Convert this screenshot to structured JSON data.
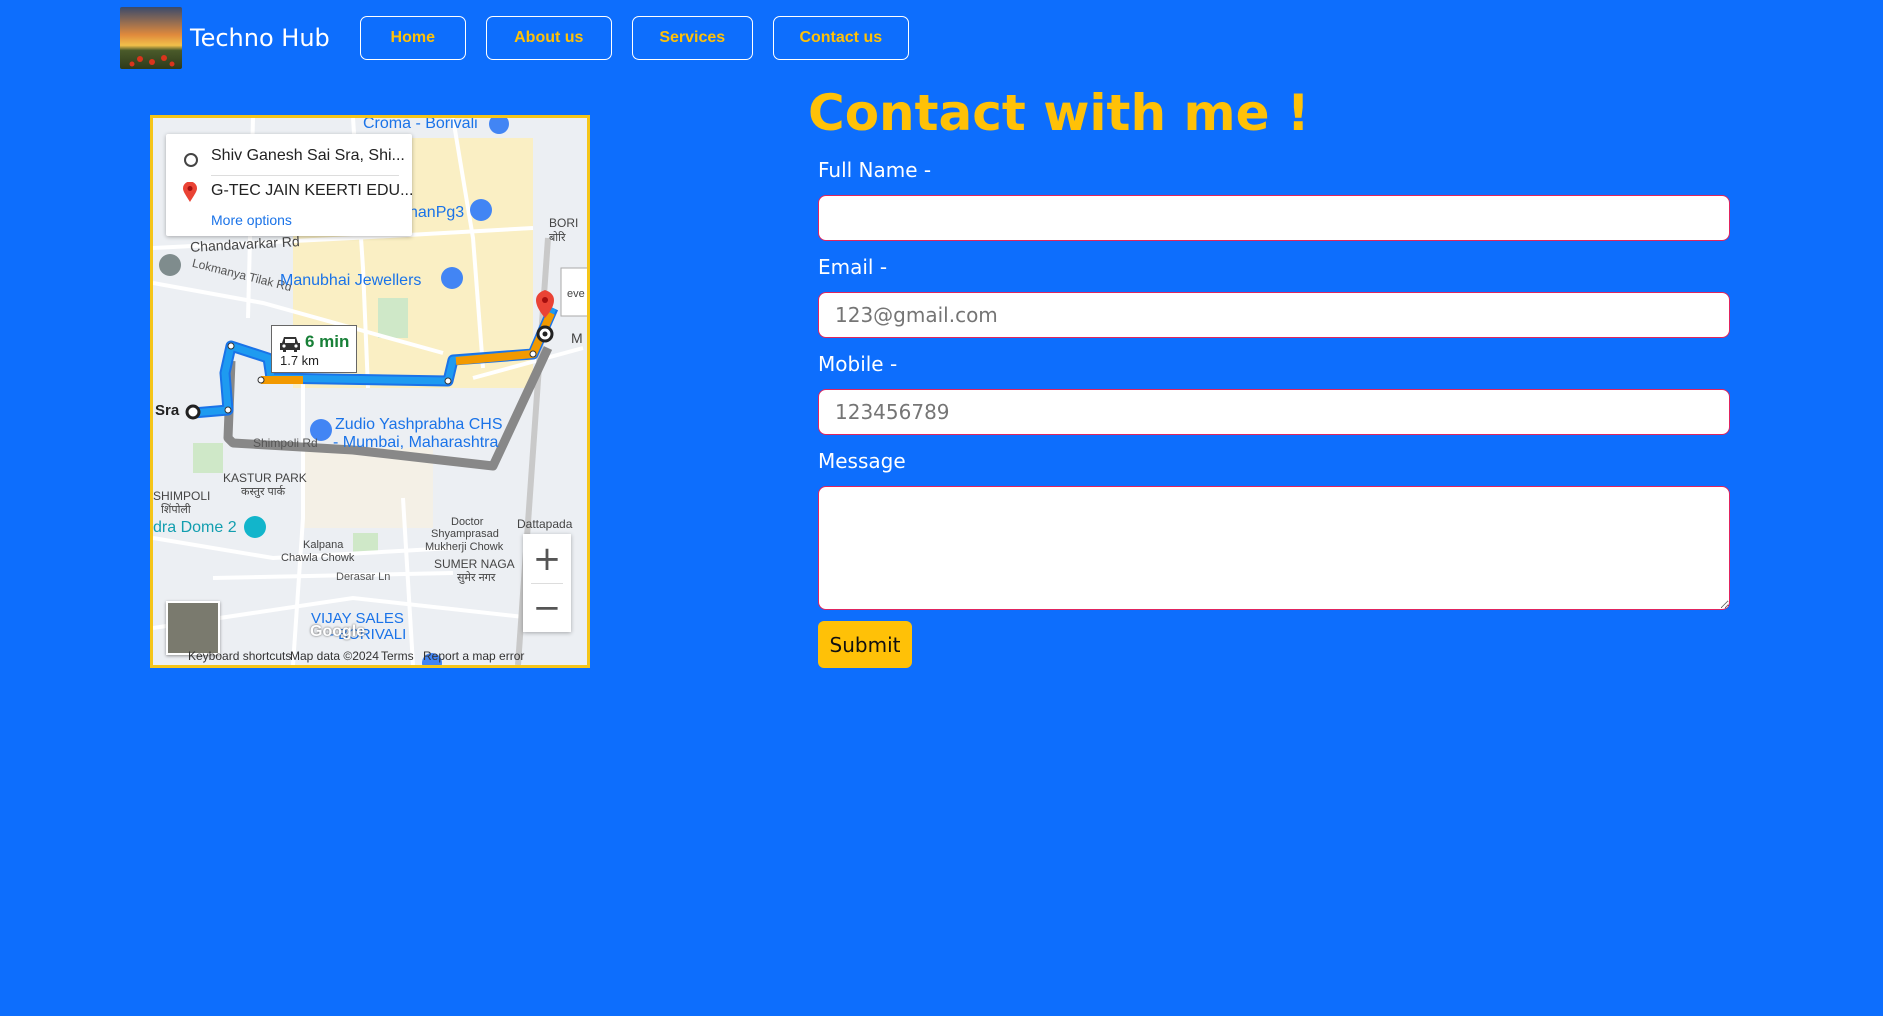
{
  "nav": {
    "brand": "Techno Hub",
    "links": [
      {
        "label": "Home"
      },
      {
        "label": "About us"
      },
      {
        "label": "Services"
      },
      {
        "label": "Contact us"
      }
    ]
  },
  "map": {
    "route": {
      "origin": "Shiv Ganesh Sai Sra, Shi...",
      "destination": "G-TEC JAIN KEERTI EDU...",
      "more_options": "More options",
      "duration": "6 min",
      "distance": "1.7 km"
    },
    "labels": {
      "croma": "Croma - Borivali",
      "chandavarkar": "Chandavarkar Rd",
      "lokmanya": "Lokmanya Tilak Rd",
      "manubhai": "Manubhai Jewellers",
      "hanpg": "hanPg3",
      "bori": "BORI",
      "bori_hi": "बोरि",
      "sra": "Sra",
      "zudio1": "Zudio Yashprabha CHS",
      "zudio2": "- Mumbai, Maharashtra",
      "shimpoli_rd": "Shimpoli Rd",
      "kastur": "KASTUR PARK",
      "kastur_hi": "कस्तुर पार्क",
      "shimpoli": "SHIMPOLI",
      "shimpoli_hi": "शिंपोली",
      "dome": "dra Dome 2",
      "doctor1": "Doctor",
      "doctor2": "Shyamprasad",
      "doctor3": "Mukherji Chowk",
      "dattapada": "Dattapada",
      "kalpana1": "Kalpana",
      "kalpana2": "Chawla Chowk",
      "sumer": "SUMER NAGA",
      "sumer_hi": "सुमेर नगर",
      "derasar": "Derasar Ln",
      "vijay1": "VIJAY SALES",
      "vijay2": "- BORIVALI",
      "eve": "eve",
      "m": "M"
    },
    "attribution": {
      "shortcuts": "Keyboard shortcuts",
      "data": "Map data ©2024",
      "terms": "Terms",
      "report": "Report a map error",
      "google": "Google"
    },
    "zoom_in": "+",
    "zoom_out": "−"
  },
  "form": {
    "heading": "Contact with me !",
    "fullname_label": "Full Name -",
    "email_label": "Email -",
    "email_placeholder": "123@gmail.com",
    "mobile_label": "Mobile -",
    "mobile_placeholder": "123456789",
    "message_label": "Message",
    "submit": "Submit"
  },
  "colors": {
    "background": "#0d6efd",
    "accent": "#ffc107",
    "field_border": "#e0245e"
  }
}
